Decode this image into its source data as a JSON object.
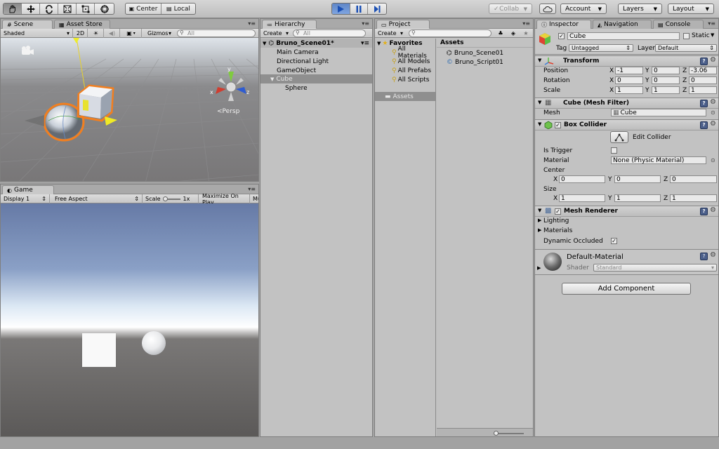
{
  "toolbar": {
    "pivot_mode": "Center",
    "pivot_rotation": "Local",
    "collab_label": "Collab",
    "account_label": "Account",
    "layers_label": "Layers",
    "layout_label": "Layout"
  },
  "scene_panel": {
    "tabs": [
      {
        "label": "Scene"
      },
      {
        "label": "Asset Store"
      }
    ],
    "shading_mode": "Shaded",
    "mode_2d": "2D",
    "gizmos_label": "Gizmos",
    "search_placeholder": "All",
    "persp_label": "Persp",
    "gizmo_axes": {
      "x": "x",
      "y": "y",
      "z": "z"
    }
  },
  "game_panel": {
    "tab_label": "Game",
    "display": "Display 1",
    "aspect": "Free Aspect",
    "scale_label": "Scale",
    "scale_value": "1x",
    "maximize_label": "Maximize On Play",
    "mute_label": "Mu"
  },
  "hierarchy": {
    "tab_label": "Hierarchy",
    "create_label": "Create",
    "search_placeholder": "All",
    "scene_name": "Bruno_Scene01*",
    "items": [
      {
        "label": "Main Camera"
      },
      {
        "label": "Directional Light"
      },
      {
        "label": "GameObject"
      },
      {
        "label": "Cube"
      },
      {
        "label": "Sphere"
      }
    ]
  },
  "project": {
    "tab_label": "Project",
    "create_label": "Create",
    "favorites_label": "Favorites",
    "favorites": [
      {
        "label": "All Materials"
      },
      {
        "label": "All Models"
      },
      {
        "label": "All Prefabs"
      },
      {
        "label": "All Scripts"
      }
    ],
    "assets_folder": "Assets",
    "assets_header": "Assets",
    "assets": [
      {
        "label": "Bruno_Scene01"
      },
      {
        "label": "Bruno_Script01"
      }
    ]
  },
  "inspector": {
    "tabs": [
      {
        "label": "Inspector"
      },
      {
        "label": "Navigation"
      },
      {
        "label": "Console"
      }
    ],
    "object_name": "Cube",
    "static_label": "Static",
    "tag_label": "Tag",
    "tag_value": "Untagged",
    "layer_label": "Layer",
    "layer_value": "Default",
    "transform": {
      "title": "Transform",
      "position_label": "Position",
      "rotation_label": "Rotation",
      "scale_label": "Scale",
      "position": {
        "x": "-1",
        "y": "0",
        "z": "-3.06"
      },
      "rotation": {
        "x": "0",
        "y": "0",
        "z": "0"
      },
      "scale": {
        "x": "1",
        "y": "1",
        "z": "1"
      }
    },
    "mesh_filter": {
      "title": "Cube (Mesh Filter)",
      "mesh_label": "Mesh",
      "mesh_value": "Cube"
    },
    "box_collider": {
      "title": "Box Collider",
      "edit_label": "Edit Collider",
      "is_trigger_label": "Is Trigger",
      "material_label": "Material",
      "material_value": "None (Physic Material)",
      "center_label": "Center",
      "size_label": "Size",
      "center": {
        "x": "0",
        "y": "0",
        "z": "0"
      },
      "size": {
        "x": "1",
        "y": "1",
        "z": "1"
      }
    },
    "mesh_renderer": {
      "title": "Mesh Renderer",
      "lighting_label": "Lighting",
      "materials_label": "Materials",
      "dynamic_occluded_label": "Dynamic Occluded"
    },
    "material": {
      "name": "Default-Material",
      "shader_label": "Shader",
      "shader_value": "Standard"
    },
    "add_component_label": "Add Component",
    "axis_labels": {
      "x": "X",
      "y": "Y",
      "z": "Z"
    }
  },
  "colors": {
    "accent": "#4d78c9",
    "selection_outline": "#f27f1f"
  }
}
